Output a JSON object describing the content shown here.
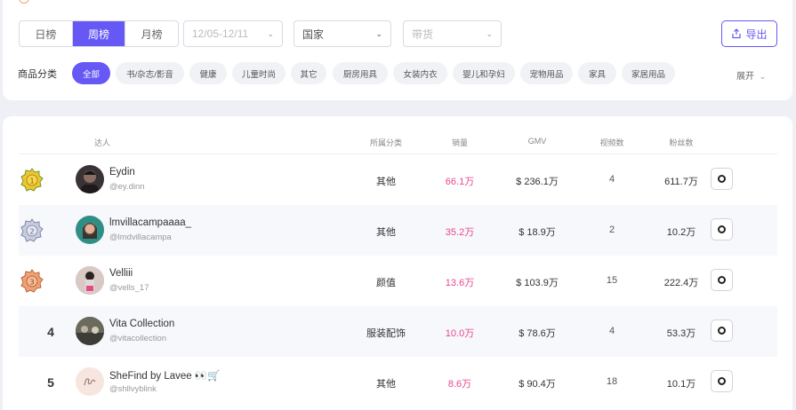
{
  "filters": {
    "period_tabs": [
      {
        "label": "日榜",
        "active": false
      },
      {
        "label": "周榜",
        "active": true
      },
      {
        "label": "月榜",
        "active": false
      }
    ],
    "date_range": "12/05-12/11",
    "country": "国家",
    "category_select": "带货",
    "export_label": "导出"
  },
  "categories": {
    "label": "商品分类",
    "items": [
      {
        "label": "全部",
        "active": true
      },
      {
        "label": "书/杂志/影音",
        "active": false
      },
      {
        "label": "健康",
        "active": false
      },
      {
        "label": "儿童时尚",
        "active": false
      },
      {
        "label": "其它",
        "active": false
      },
      {
        "label": "厨房用具",
        "active": false
      },
      {
        "label": "女装内衣",
        "active": false
      },
      {
        "label": "婴儿和孕妇",
        "active": false
      },
      {
        "label": "宠物用品",
        "active": false
      },
      {
        "label": "家具",
        "active": false
      },
      {
        "label": "家居用品",
        "active": false
      }
    ],
    "expand_label": "展开"
  },
  "table": {
    "headers": {
      "influencer": "达人",
      "category": "所属分类",
      "sales": "销量",
      "gmv": "GMV",
      "videos": "视频数",
      "fans": "粉丝数"
    },
    "rows": [
      {
        "rank": "1",
        "name": "Eydin",
        "handle": "@ey.dinn",
        "category": "其他",
        "sales": "66.1万",
        "gmv": "$ 236.1万",
        "videos": "4",
        "fans": "611.7万",
        "medal": "gold-medal-icon",
        "avatar_color": "#3a3335"
      },
      {
        "rank": "2",
        "name": "lmvillacampaaaa_",
        "handle": "@lmdvillacampa",
        "category": "其他",
        "sales": "35.2万",
        "gmv": "$ 18.9万",
        "videos": "2",
        "fans": "10.2万",
        "medal": "silver-medal-icon",
        "avatar_color": "#2f8f86"
      },
      {
        "rank": "3",
        "name": "Velliii",
        "handle": "@vells_17",
        "category": "颜值",
        "sales": "13.6万",
        "gmv": "$ 103.9万",
        "videos": "15",
        "fans": "222.4万",
        "medal": "bronze-medal-icon",
        "avatar_color": "#c9a7a9"
      },
      {
        "rank": "4",
        "name": "Vita Collection",
        "handle": "@vitacollection",
        "category": "服装配饰",
        "sales": "10.0万",
        "gmv": "$ 78.6万",
        "videos": "4",
        "fans": "53.3万",
        "medal": "",
        "avatar_color": "#5a5a52"
      },
      {
        "rank": "5",
        "name": "SheFind by Lavee 👀🛒",
        "handle": "@shllvyblink",
        "category": "其他",
        "sales": "8.6万",
        "gmv": "$ 90.4万",
        "videos": "18",
        "fans": "10.1万",
        "medal": "",
        "avatar_color": "#f6e4dc"
      }
    ]
  }
}
